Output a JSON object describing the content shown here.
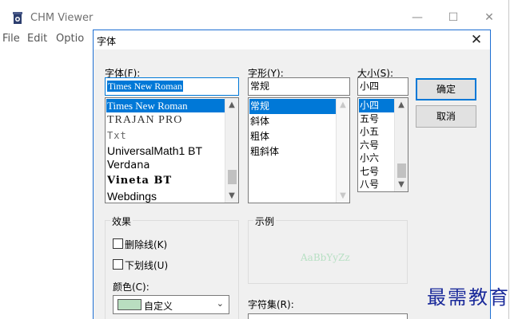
{
  "app": {
    "title": "CHM Viewer",
    "menu": [
      "File",
      "Edit",
      "Optio"
    ],
    "window_buttons": {
      "minimize": "—",
      "maximize": "☐",
      "close": "✕"
    }
  },
  "dialog": {
    "title": "字体",
    "close": "✕",
    "font": {
      "label": "字体(F):",
      "value": "Times New Roman",
      "items": [
        "Times New Roman",
        "TRAJAN PRO",
        "Txt",
        "UniversalMath1 BT",
        "Verdana",
        "Vineta BT",
        "Webdings"
      ],
      "selected_index": 0
    },
    "style": {
      "label": "字形(Y):",
      "value": "常规",
      "items": [
        "常规",
        "斜体",
        "粗体",
        "粗斜体"
      ],
      "selected_index": 0
    },
    "size": {
      "label": "大小(S):",
      "value": "小四",
      "items": [
        "小四",
        "五号",
        "小五",
        "六号",
        "小六",
        "七号",
        "八号"
      ],
      "selected_index": 0
    },
    "buttons": {
      "ok": "确定",
      "cancel": "取消"
    },
    "effects": {
      "title": "效果",
      "strikeout": "删除线(K)",
      "underline": "下划线(U)",
      "color_label": "颜色(C):",
      "color_value": "自定义",
      "color_swatch": "#b9dec0"
    },
    "sample": {
      "title": "示例",
      "text": "AaBbYyZz"
    },
    "charset": {
      "label": "字符集(R):"
    }
  },
  "watermark": "最需教育"
}
